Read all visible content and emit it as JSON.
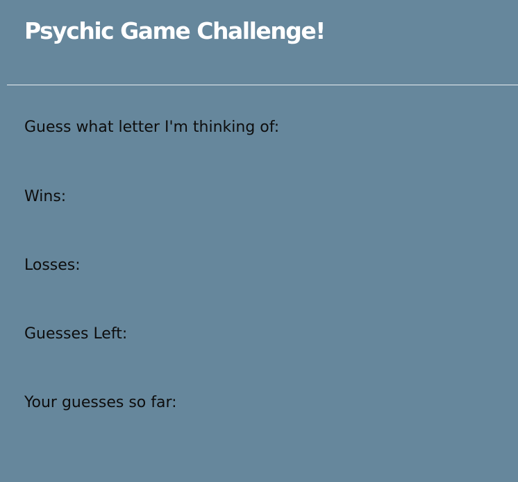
{
  "header": {
    "title": "Psychic Game Challenge!"
  },
  "game": {
    "prompt_label": "Guess what letter I'm thinking of:",
    "wins_label": "Wins:",
    "wins_value": "",
    "losses_label": "Losses:",
    "losses_value": "",
    "guesses_left_label": "Guesses Left:",
    "guesses_left_value": "",
    "guesses_so_far_label": "Your guesses so far:",
    "guesses_so_far_value": ""
  },
  "colors": {
    "background": "#66879c",
    "title": "#ffffff",
    "text": "#0d0d0d",
    "divider": "#e9eef1"
  }
}
